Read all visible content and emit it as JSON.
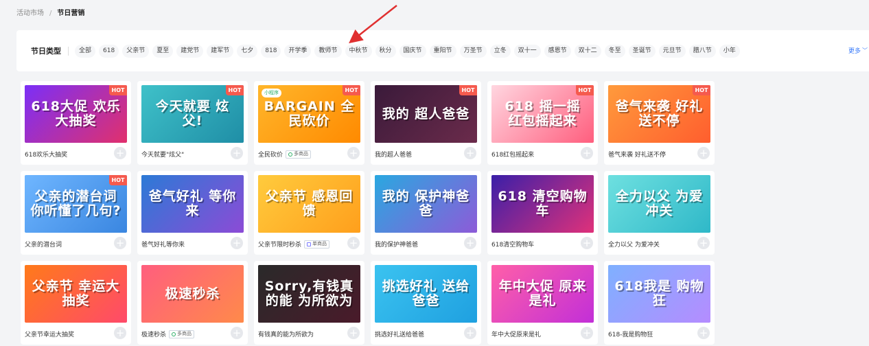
{
  "breadcrumb": {
    "parent": "活动市场",
    "separator": "/",
    "current": "节日营销"
  },
  "filter": {
    "label": "节日类型",
    "chips": [
      "全部",
      "618",
      "父亲节",
      "夏至",
      "建党节",
      "建军节",
      "七夕",
      "818",
      "开学季",
      "教师节",
      "中秋节",
      "秋分",
      "国庆节",
      "重阳节",
      "万圣节",
      "立冬",
      "双十一",
      "感恩节",
      "双十二",
      "冬至",
      "圣诞节",
      "元旦节",
      "腊八节",
      "小年"
    ],
    "more_label": "更多",
    "more_icon": "chevron-down-icon"
  },
  "hot_label": "HOT",
  "mini_program_label": "小程序",
  "cards": [
    {
      "title": "618欢乐大抽奖",
      "thumb": "618大促 欢乐大抽奖",
      "hot": true,
      "bg": "linear-gradient(135deg,#7b2ff7,#e1306c)"
    },
    {
      "title": "今天就要\"炫父\"",
      "thumb": "今天就要 炫父!",
      "hot": true,
      "bg": "linear-gradient(135deg,#3fc1c9,#1f8ea6)"
    },
    {
      "title": "全民砍价",
      "thumb": "BARGAIN 全民砍价",
      "hot": true,
      "badge": "多商品",
      "mini": true,
      "bg": "linear-gradient(135deg,#ffb62b,#ff8a00)"
    },
    {
      "title": "我的超人爸爸",
      "thumb": "我的 超人爸爸",
      "hot": true,
      "bg": "linear-gradient(135deg,#3a1a3a,#6b2b4b)"
    },
    {
      "title": "618红包摇起来",
      "thumb": "618 摇一摇 红包摇起来",
      "hot": true,
      "bg": "linear-gradient(135deg,#ffd6e0,#ff5e7e)"
    },
    {
      "title": "爸气来袭 好礼送不停",
      "thumb": "爸气来袭 好礼送不停",
      "hot": true,
      "bg": "linear-gradient(135deg,#ff9a3c,#ff5e2e)"
    },
    {
      "title": "父亲的潜台词",
      "thumb": "父亲的潜台词 你听懂了几句?",
      "hot": true,
      "bg": "linear-gradient(135deg,#6fb6ff,#3a86e0)"
    },
    {
      "title": "爸气好礼等你来",
      "thumb": "爸气好礼 等你来",
      "hot": false,
      "bg": "linear-gradient(135deg,#2c7ad6,#8c4bd6)"
    },
    {
      "title": "父亲节限时秒杀",
      "thumb": "父亲节 感恩回馈",
      "hot": false,
      "badge": "单商品",
      "bg": "linear-gradient(135deg,#ffcb3d,#ff9f1c)"
    },
    {
      "title": "我的保护神爸爸",
      "thumb": "我的 保护神爸爸",
      "hot": false,
      "bg": "linear-gradient(135deg,#2aa8e0,#8d5bd8)"
    },
    {
      "title": "618清空购物车",
      "thumb": "618 清空购物车",
      "hot": false,
      "bg": "linear-gradient(135deg,#3a1fa8,#e0317a)"
    },
    {
      "title": "全力以父 为爱冲关",
      "thumb": "全力以父 为爱冲关",
      "hot": false,
      "bg": "linear-gradient(135deg,#6ee0e0,#2fb8c8)"
    },
    {
      "title": "父亲节幸运大抽奖",
      "thumb": "父亲节 幸运大抽奖",
      "hot": false,
      "bg": "linear-gradient(135deg,#ff7a1a,#ff4a6a)"
    },
    {
      "title": "极速秒杀",
      "thumb": "极速秒杀",
      "hot": false,
      "badge": "多商品",
      "bg": "linear-gradient(135deg,#ff5e7e,#ff8a4a)"
    },
    {
      "title": "有钱真的能为所欲为",
      "thumb": "Sorry,有钱真的能 为所欲为",
      "hot": false,
      "bg": "linear-gradient(135deg,#2a2a2a,#4a1a2a)"
    },
    {
      "title": "挑选好礼送给爸爸",
      "thumb": "挑选好礼 送给爸爸",
      "hot": false,
      "bg": "linear-gradient(135deg,#3bc3f0,#1fa0e0)"
    },
    {
      "title": "年中大促原来是礼",
      "thumb": "年中大促 原来是礼",
      "hot": false,
      "bg": "linear-gradient(135deg,#ff5fa8,#c22fd8)"
    },
    {
      "title": "618-我是购物狂",
      "thumb": "618我是 购物狂",
      "hot": false,
      "bg": "linear-gradient(135deg,#7fb0ff,#b58cff)"
    }
  ]
}
